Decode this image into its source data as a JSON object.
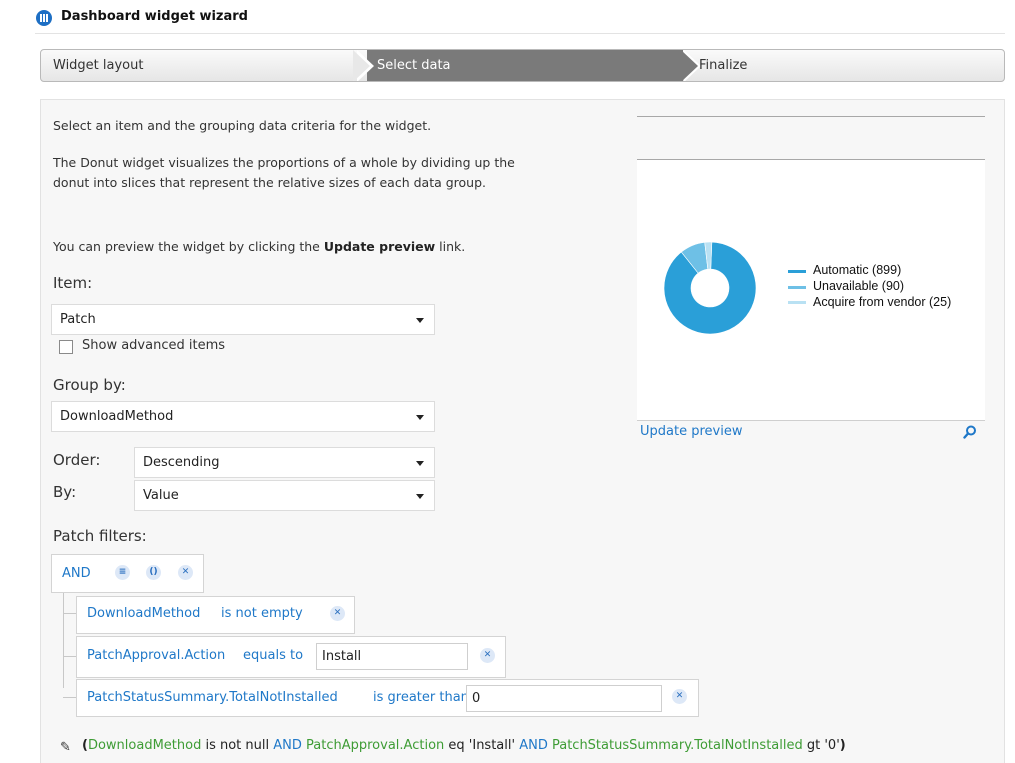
{
  "window": {
    "title": "Dashboard widget wizard"
  },
  "wizard": {
    "steps": [
      {
        "label": "Widget layout",
        "state": "done"
      },
      {
        "label": "Select data",
        "state": "active"
      },
      {
        "label": "Finalize",
        "state": "pending"
      }
    ]
  },
  "intro": {
    "p1": "Select an item and the grouping data criteria for the widget.",
    "p2": "The Donut widget visualizes the proportions of a whole by dividing up the donut into slices that represent the relative sizes of each data group.",
    "p3_pre": "You can preview the widget by clicking the ",
    "p3_bold": "Update preview",
    "p3_post": " link."
  },
  "form": {
    "item_label": "Item:",
    "item_value": "Patch",
    "show_advanced_label": "Show advanced items",
    "show_advanced_checked": false,
    "group_by_label": "Group by:",
    "group_by_value": "DownloadMethod",
    "order_label": "Order:",
    "order_value": "Descending",
    "by_label": "By:",
    "by_value": "Value"
  },
  "filters": {
    "label": "Patch filters:",
    "group_operator": "AND",
    "group_icons": [
      "add-condition-icon",
      "add-group-icon",
      "remove-icon"
    ],
    "conditions": [
      {
        "field": "DownloadMethod",
        "operator": "is not empty",
        "value": null
      },
      {
        "field": "PatchApproval.Action",
        "operator": "equals to",
        "value": "Install"
      },
      {
        "field": "PatchStatusSummary.TotalNotInstalled",
        "operator": "is greater than",
        "value": "0"
      }
    ],
    "expression": {
      "open": "(",
      "c1_field": "DownloadMethod",
      "c1_rest": " is not null ",
      "and1": "AND",
      "c2_field": " PatchApproval.Action",
      "c2_rest": " eq 'Install' ",
      "and2": "AND",
      "c3_field": " PatchStatusSummary.TotalNotInstalled",
      "c3_rest": " gt '0'",
      "close": ")"
    }
  },
  "preview": {
    "update_link": "Update preview",
    "colors": {
      "accent": "#1f78c8"
    }
  },
  "chart_data": {
    "type": "pie",
    "donut": true,
    "categories": [
      "Automatic",
      "Unavailable",
      "Acquire from vendor"
    ],
    "values": [
      899,
      90,
      25
    ],
    "legend_labels": [
      "Automatic (899)",
      "Unavailable (90)",
      "Acquire from vendor (25)"
    ],
    "colors": [
      "#2a9fd8",
      "#6ec0e6",
      "#b9e1f3"
    ],
    "legend": "right"
  }
}
